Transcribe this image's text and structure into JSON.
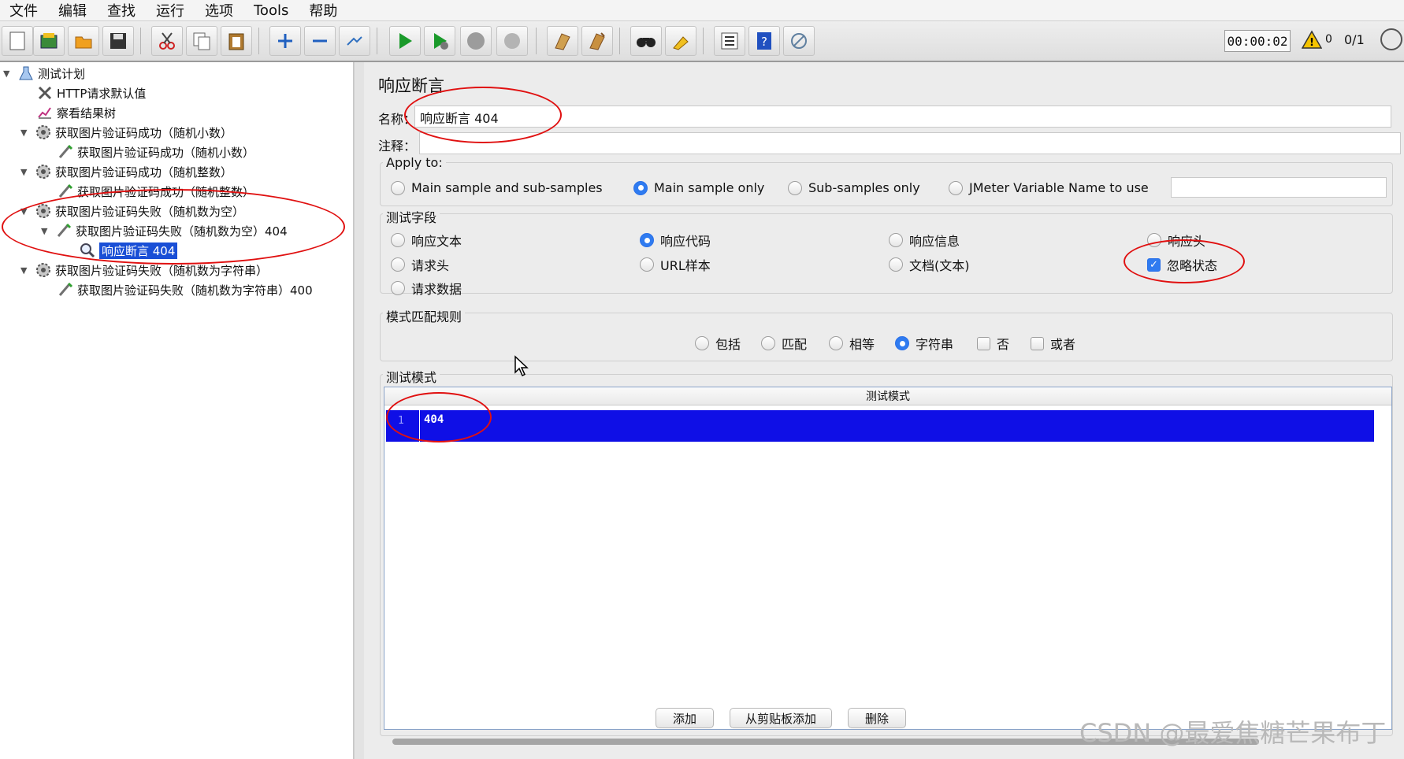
{
  "menu": [
    "文件",
    "编辑",
    "查找",
    "运行",
    "选项",
    "Tools",
    "帮助"
  ],
  "toolbar": {
    "buttons": [
      "new-icon",
      "templates-icon",
      "open-icon",
      "save-icon",
      "cut-icon",
      "copy-icon",
      "paste-icon",
      "expand-icon",
      "collapse-icon",
      "toggle-icon",
      "start-icon",
      "start-no-pause-icon",
      "stop-icon",
      "shutdown-icon",
      "clear-icon",
      "clear-all-icon",
      "search-icon",
      "reset-search-icon",
      "function-helper-icon",
      "help-icon",
      "remote-icon"
    ],
    "timer": "00:00:02",
    "warnings": "0",
    "threads": "0/1"
  },
  "tree": {
    "items": [
      {
        "label": "测试计划",
        "icon": "test-plan-icon",
        "level": 0,
        "expanded": true
      },
      {
        "label": "HTTP请求默认值",
        "icon": "config-icon",
        "level": 1
      },
      {
        "label": "察看结果树",
        "icon": "listener-icon",
        "level": 1
      },
      {
        "label": "获取图片验证码成功（随机小数）",
        "icon": "thread-group-icon",
        "level": 1,
        "expanded": true
      },
      {
        "label": "获取图片验证码成功（随机小数）",
        "icon": "sampler-icon",
        "level": 2
      },
      {
        "label": "获取图片验证码成功（随机整数）",
        "icon": "thread-group-icon",
        "level": 1,
        "expanded": true
      },
      {
        "label": "获取图片验证码成功（随机整数）",
        "icon": "sampler-icon",
        "level": 2
      },
      {
        "label": "获取图片验证码失败（随机数为空）",
        "icon": "thread-group-icon",
        "level": 1,
        "expanded": true
      },
      {
        "label": "获取图片验证码失败（随机数为空）404",
        "icon": "sampler-icon",
        "level": 2,
        "expanded": true
      },
      {
        "label": "响应断言 404",
        "icon": "assertion-icon",
        "level": 3,
        "selected": true
      },
      {
        "label": "获取图片验证码失败（随机数为字符串）",
        "icon": "thread-group-icon",
        "level": 1,
        "expanded": true
      },
      {
        "label": "获取图片验证码失败（随机数为字符串）400",
        "icon": "sampler-icon",
        "level": 2
      }
    ]
  },
  "panel": {
    "title": "响应断言",
    "name_label": "名称：",
    "name_value": "响应断言 404",
    "comment_label": "注释：",
    "comment_value": "",
    "apply_to": {
      "title": "Apply to:",
      "options": [
        "Main sample and sub-samples",
        "Main sample only",
        "Sub-samples only",
        "JMeter Variable Name to use"
      ],
      "selected": "Main sample only",
      "variable_value": ""
    },
    "test_field": {
      "title": "测试字段",
      "options": [
        "响应文本",
        "响应代码",
        "响应信息",
        "响应头",
        "请求头",
        "URL样本",
        "文档(文本)",
        "请求数据"
      ],
      "selected": "响应代码",
      "ignore_status_label": "忽略状态",
      "ignore_status": true
    },
    "pattern_rules": {
      "title": "模式匹配规则",
      "radios": [
        "包括",
        "匹配",
        "相等",
        "字符串"
      ],
      "selected": "字符串",
      "checks": [
        "否",
        "或者"
      ]
    },
    "patterns": {
      "title": "测试模式",
      "column": "测试模式",
      "rows": [
        {
          "line": "1",
          "value": "404"
        }
      ]
    },
    "buttons": {
      "add": "添加",
      "add_clipboard": "从剪贴板添加",
      "delete": "删除"
    }
  },
  "watermark": "CSDN @最爱焦糖芒果布丁",
  "colors": {
    "selection": "#1a4fd6",
    "pattern_row": "#0f0fe6",
    "radio_on": "#2f7bf0",
    "annotation": "#e01010"
  }
}
